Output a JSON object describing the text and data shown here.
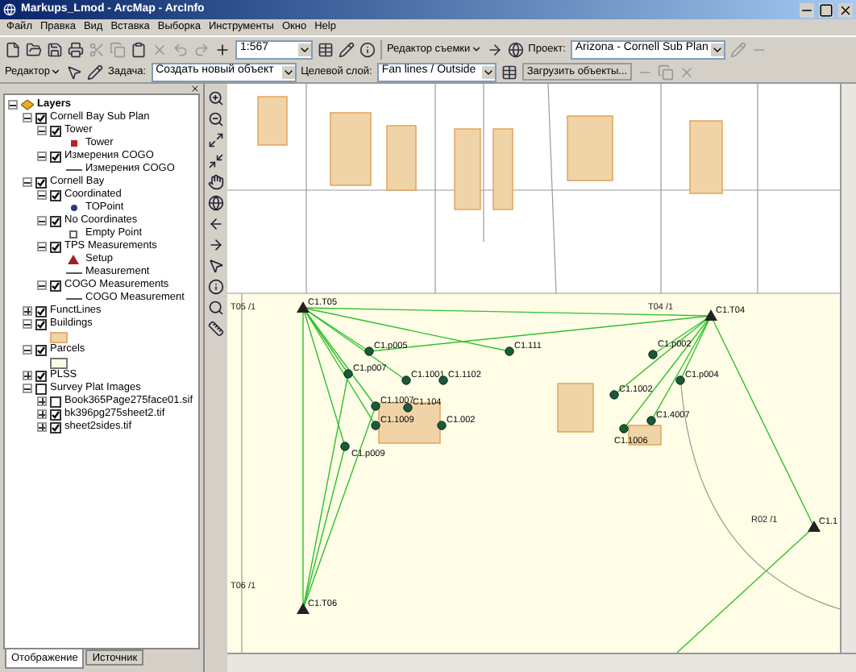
{
  "window": {
    "title": "Markups_Lmod - ArcMap - ArcInfo"
  },
  "menu": [
    "Файл",
    "Правка",
    "Вид",
    "Вставка",
    "Выборка",
    "Инструменты",
    "Окно",
    "Help"
  ],
  "toolbar_1": {
    "scale": "1:567",
    "survey_editor": "Редактор съемки",
    "project_label": "Проект:",
    "project": "Arizona - Cornell Sub Plan"
  },
  "toolbar_2": {
    "editor": "Редактор",
    "task_label": "Задача:",
    "task": "Создать новый объект",
    "target_label": "Целевой слой:",
    "target": "Fan lines / Outside",
    "load_button": "Загрузить объекты..."
  },
  "toc": {
    "layers": [
      {
        "label": "Layers",
        "kind": "root",
        "expanded": true,
        "children": [
          {
            "label": "Cornell Bay Sub Plan",
            "kind": "layer",
            "checked": true,
            "expanded": true,
            "children": [
              {
                "label": "Tower",
                "kind": "layer",
                "checked": true,
                "expanded": true,
                "children": [
                  {
                    "label": "Tower",
                    "kind": "square"
                  }
                ]
              },
              {
                "label": "Измерения COGO",
                "kind": "layer",
                "checked": true,
                "expanded": true,
                "children": [
                  {
                    "label": "Измерения COGO",
                    "kind": "line"
                  }
                ]
              }
            ]
          },
          {
            "label": "Cornell Bay",
            "kind": "layer",
            "checked": true,
            "expanded": true,
            "children": [
              {
                "label": "Coordinated",
                "kind": "layer",
                "checked": true,
                "expanded": true,
                "children": [
                  {
                    "label": "TOPoint",
                    "kind": "dot"
                  }
                ]
              },
              {
                "label": "No Coordinates",
                "kind": "layer",
                "checked": true,
                "expanded": true,
                "children": [
                  {
                    "label": "Empty Point",
                    "kind": "hollow"
                  }
                ]
              },
              {
                "label": "TPS Measurements",
                "kind": "layer",
                "checked": true,
                "expanded": true,
                "children": [
                  {
                    "label": "Setup",
                    "kind": "triangle"
                  },
                  {
                    "label": "Measurement",
                    "kind": "line"
                  }
                ]
              },
              {
                "label": "COGO Measurements",
                "kind": "layer",
                "checked": true,
                "expanded": true,
                "children": [
                  {
                    "label": "COGO Measurement",
                    "kind": "line"
                  }
                ]
              }
            ]
          },
          {
            "label": "FunctLines",
            "kind": "layer",
            "checked": true,
            "expanded": false
          },
          {
            "label": "Buildings",
            "kind": "layer",
            "checked": true,
            "expanded": true,
            "children": [
              {
                "kind": "patch"
              }
            ]
          },
          {
            "label": "Parcels",
            "kind": "layer",
            "checked": true,
            "expanded": true,
            "children": [
              {
                "kind": "outline"
              }
            ]
          },
          {
            "label": "PLSS",
            "kind": "layer",
            "checked": true,
            "expanded": false
          },
          {
            "label": "Survey Plat Images",
            "kind": "layer",
            "checked": false,
            "expanded": true,
            "children": [
              {
                "label": "Book365Page275face01.sif",
                "kind": "layer",
                "checked": false,
                "expanded": false
              },
              {
                "label": "bk396pg275sheet2.tif",
                "kind": "layer",
                "checked": true,
                "expanded": false
              },
              {
                "label": "sheet2sides.tif",
                "kind": "layer",
                "checked": true,
                "expanded": false
              }
            ]
          }
        ]
      }
    ]
  },
  "toc_tabs": [
    {
      "label": "Отображение",
      "selected": true
    },
    {
      "label": "Источник",
      "selected": false
    }
  ],
  "map": {
    "points": [
      {
        "label": "C1.T05",
        "kind": "station"
      },
      {
        "label": "C1.T04",
        "kind": "station"
      },
      {
        "label": "C1.p005",
        "kind": "point"
      },
      {
        "label": "C1.111",
        "kind": "point"
      },
      {
        "label": "C1.p002",
        "kind": "point"
      },
      {
        "label": "C1.p007",
        "kind": "point"
      },
      {
        "label": "C1.1001",
        "kind": "point"
      },
      {
        "label": "C1.1102",
        "kind": "point"
      },
      {
        "label": "C1.p004",
        "kind": "point"
      },
      {
        "label": "C1.1002",
        "kind": "point"
      },
      {
        "label": "C1.1007",
        "kind": "point"
      },
      {
        "label": "C1.104",
        "kind": "point"
      },
      {
        "label": "C1.4007",
        "kind": "point"
      },
      {
        "label": "C1.1009",
        "kind": "point"
      },
      {
        "label": "C1.002",
        "kind": "point"
      },
      {
        "label": "C1.1006",
        "kind": "point"
      },
      {
        "label": "C1.p009",
        "kind": "point"
      },
      {
        "label": "C1.1",
        "kind": "station"
      },
      {
        "label": "C1.T06",
        "kind": "station"
      }
    ],
    "line_labels": [
      "T05 /1",
      "T04 /1",
      "R02 /1",
      "T06 /1"
    ]
  }
}
